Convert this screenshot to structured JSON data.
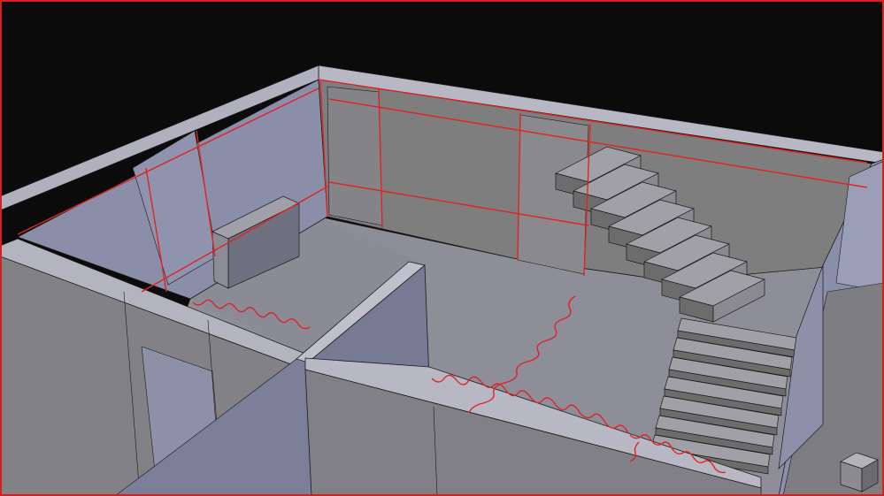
{
  "viewport": {
    "background": "#0b0b0b",
    "frame_color": "#d61f1f"
  },
  "colors": {
    "floor": "#8e8e98",
    "floor_dark": "#7c7c86",
    "wall_top": "#b8b8c4",
    "wall_lit": "#aaaab8",
    "wall_shadow": "#6f7080",
    "wall_blue": "#8a8ea8",
    "wall_grey": "#7e7e7e",
    "stair_top": "#a0a0a6",
    "stair_face": "#6c6c6c",
    "edge": "#1a1a1a",
    "guide_line": "#e02424"
  },
  "scene": {
    "objects": [
      "room-floor",
      "perimeter-walls",
      "interior-partition",
      "bench-block",
      "upper-staircase",
      "lower-staircase",
      "corner-cube"
    ],
    "cracks": [
      "crack-left-floor",
      "crack-diagonal",
      "crack-front",
      "crack-right"
    ],
    "guide_lines_visible": true,
    "stair_upper_steps": 8,
    "stair_lower_steps": 7
  }
}
